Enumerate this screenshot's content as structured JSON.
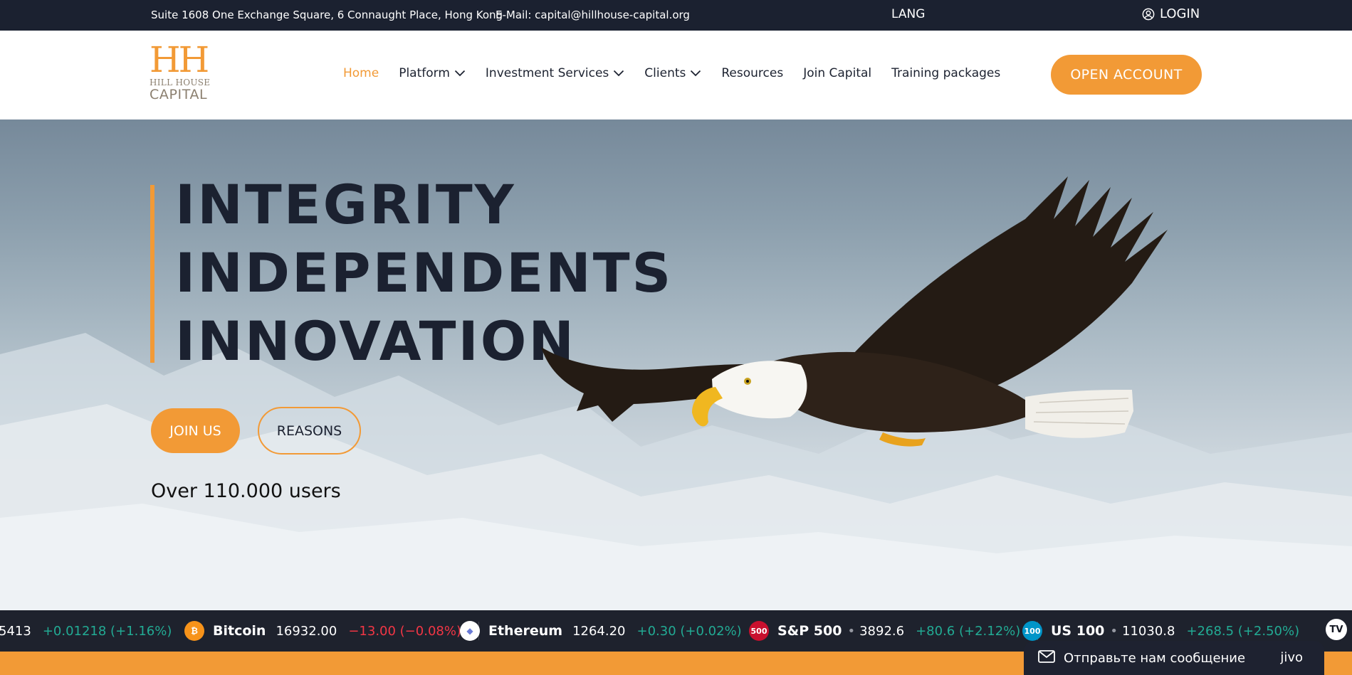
{
  "topbar": {
    "address": "Suite 1608 One Exchange Square, 6 Connaught Place, Hong Kong",
    "email": "E-Mail: capital@hillhouse-capital.org",
    "lang": "LANG",
    "login": "LOGIN"
  },
  "logo": {
    "monogram": "HH",
    "line1": "HILL HOUSE",
    "line2": "CAPITAL"
  },
  "nav": {
    "items": [
      {
        "label": "Home",
        "active": true,
        "dropdown": false
      },
      {
        "label": "Platform",
        "active": false,
        "dropdown": true
      },
      {
        "label": "Investment Services",
        "active": false,
        "dropdown": true
      },
      {
        "label": "Clients",
        "active": false,
        "dropdown": true
      },
      {
        "label": "Resources",
        "active": false,
        "dropdown": false
      },
      {
        "label": "Join Capital",
        "active": false,
        "dropdown": false
      },
      {
        "label": "Training packages",
        "active": false,
        "dropdown": false
      }
    ],
    "cta": "OPEN ACCOUNT"
  },
  "hero": {
    "lines": [
      "INTEGRITY",
      "INDEPENDENTS",
      "INNOVATION"
    ],
    "join_button": "JOIN US",
    "reasons_button": "REASONS",
    "users_text": "Over 110.000 users"
  },
  "ticker": [
    {
      "icon": "",
      "name": "",
      "price": "5413",
      "change": "+0.01218 (+1.16%)",
      "direction": "up"
    },
    {
      "icon": "₿",
      "icon_color": "#f7931a",
      "name": "Bitcoin",
      "price": "16932.00",
      "change": "−13.00 (−0.08%)",
      "direction": "down"
    },
    {
      "icon": "◆",
      "icon_color": "#ffffff",
      "name": "Ethereum",
      "price": "1264.20",
      "change": "+0.30 (+0.02%)",
      "direction": "up"
    },
    {
      "icon": "500",
      "icon_color": "#c8102e",
      "name": "S&P 500",
      "price": "3892.6",
      "change": "+80.6 (+2.12%)",
      "direction": "up"
    },
    {
      "icon": "100",
      "icon_color": "#0095c8",
      "name": "US 100",
      "price": "11030.8",
      "change": "+268.5 (+2.50%)",
      "direction": "up"
    }
  ],
  "chat": {
    "message": "Отправьте нам сообщение",
    "brand": "jivo"
  },
  "colors": {
    "accent": "#f29a36",
    "dark": "#1b2130",
    "up": "#22ab94",
    "down": "#f23645"
  },
  "icons": {
    "login": "user-circle-icon",
    "dropdown": "chevron-down-icon",
    "chat": "envelope-icon",
    "ticker_brand": "tradingview-logo-icon"
  }
}
